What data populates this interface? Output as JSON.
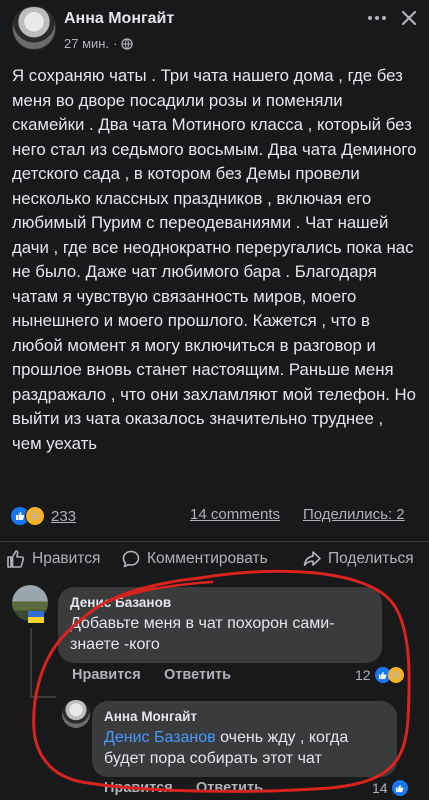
{
  "post": {
    "author": "Анна Монгайт",
    "time": "27 мин.",
    "separator": "·",
    "text": "Я сохраняю чаты . Три чата нашего дома , где без меня во дворе посадили розы и поменяли скамейки . Два чата Мотиного класса , который без него стал из седьмого восьмым. Два чата Деминого детского сада , в котором без Демы провели несколько классных праздников , включая его любимый Пурим с переодеваниями . Чат нашей дачи , где все неоднократно переругались пока нас не было. Даже чат любимого бара . Благодаря чатам я чувствую связанность миров, моего нынешнего и моего прошлого. Кажется , что в любой момент я могу включиться в разговор и прошлое вновь станет настоящим. Раньше меня раздражало , что они захламляют мой телефон. Но выйти из чата оказалось значительно труднее , чем уехать"
  },
  "stats": {
    "reaction_count": "233",
    "comments": "14 comments",
    "shares": "Поделились: 2"
  },
  "actions": {
    "like": "Нравится",
    "comment": "Комментировать",
    "share": "Поделиться"
  },
  "comments": [
    {
      "author": "Денис Базанов",
      "text": "Добавьте меня в чат похорон сами-знаете -кого",
      "like_label": "Нравится",
      "reply_label": "Ответить",
      "reaction_count": "12"
    },
    {
      "author": "Анна Монгайт",
      "mention": "Денис Базанов",
      "text": " очень жду , когда будет пора собирать этот чат",
      "like_label": "Нравится",
      "reply_label": "Ответить",
      "reaction_count": "14"
    }
  ],
  "colors": {
    "background": "#18191a",
    "bubble": "#3a3b3c",
    "text": "#e4e6eb",
    "secondary": "#b0b3b8",
    "link": "#4599ff",
    "like_blue": "#1877f2",
    "annotation_red": "#d8231f"
  },
  "icons": [
    "globe-icon",
    "more-icon",
    "close-icon",
    "like-icon",
    "comment-icon",
    "share-icon",
    "haha-icon"
  ]
}
